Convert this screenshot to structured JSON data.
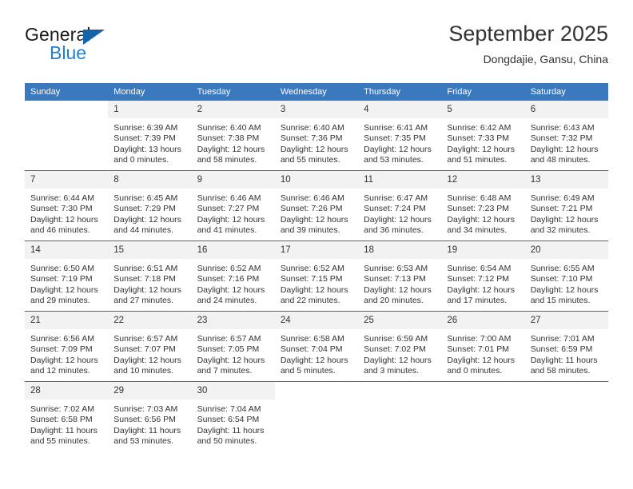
{
  "brand": {
    "name_top": "General",
    "name_bottom": "Blue",
    "triangle_icon": "brand-triangle-icon"
  },
  "header": {
    "title": "September 2025",
    "subtitle": "Dongdajie, Gansu, China"
  },
  "calendar": {
    "weekday_headers": [
      "Sunday",
      "Monday",
      "Tuesday",
      "Wednesday",
      "Thursday",
      "Friday",
      "Saturday"
    ],
    "colors": {
      "header_bg": "#3a79bd",
      "daynum_bg": "#f2f2f2",
      "row_border": "#2f6ead",
      "brand_blue": "#1f7fd0",
      "brand_triangle": "#1464aa",
      "text": "#333333"
    },
    "weeks": [
      [
        {
          "day": "",
          "sunrise": "",
          "sunset": "",
          "daylight_line1": "",
          "daylight_line2": ""
        },
        {
          "day": "1",
          "sunrise": "Sunrise: 6:39 AM",
          "sunset": "Sunset: 7:39 PM",
          "daylight_line1": "Daylight: 13 hours",
          "daylight_line2": "and 0 minutes."
        },
        {
          "day": "2",
          "sunrise": "Sunrise: 6:40 AM",
          "sunset": "Sunset: 7:38 PM",
          "daylight_line1": "Daylight: 12 hours",
          "daylight_line2": "and 58 minutes."
        },
        {
          "day": "3",
          "sunrise": "Sunrise: 6:40 AM",
          "sunset": "Sunset: 7:36 PM",
          "daylight_line1": "Daylight: 12 hours",
          "daylight_line2": "and 55 minutes."
        },
        {
          "day": "4",
          "sunrise": "Sunrise: 6:41 AM",
          "sunset": "Sunset: 7:35 PM",
          "daylight_line1": "Daylight: 12 hours",
          "daylight_line2": "and 53 minutes."
        },
        {
          "day": "5",
          "sunrise": "Sunrise: 6:42 AM",
          "sunset": "Sunset: 7:33 PM",
          "daylight_line1": "Daylight: 12 hours",
          "daylight_line2": "and 51 minutes."
        },
        {
          "day": "6",
          "sunrise": "Sunrise: 6:43 AM",
          "sunset": "Sunset: 7:32 PM",
          "daylight_line1": "Daylight: 12 hours",
          "daylight_line2": "and 48 minutes."
        }
      ],
      [
        {
          "day": "7",
          "sunrise": "Sunrise: 6:44 AM",
          "sunset": "Sunset: 7:30 PM",
          "daylight_line1": "Daylight: 12 hours",
          "daylight_line2": "and 46 minutes."
        },
        {
          "day": "8",
          "sunrise": "Sunrise: 6:45 AM",
          "sunset": "Sunset: 7:29 PM",
          "daylight_line1": "Daylight: 12 hours",
          "daylight_line2": "and 44 minutes."
        },
        {
          "day": "9",
          "sunrise": "Sunrise: 6:46 AM",
          "sunset": "Sunset: 7:27 PM",
          "daylight_line1": "Daylight: 12 hours",
          "daylight_line2": "and 41 minutes."
        },
        {
          "day": "10",
          "sunrise": "Sunrise: 6:46 AM",
          "sunset": "Sunset: 7:26 PM",
          "daylight_line1": "Daylight: 12 hours",
          "daylight_line2": "and 39 minutes."
        },
        {
          "day": "11",
          "sunrise": "Sunrise: 6:47 AM",
          "sunset": "Sunset: 7:24 PM",
          "daylight_line1": "Daylight: 12 hours",
          "daylight_line2": "and 36 minutes."
        },
        {
          "day": "12",
          "sunrise": "Sunrise: 6:48 AM",
          "sunset": "Sunset: 7:23 PM",
          "daylight_line1": "Daylight: 12 hours",
          "daylight_line2": "and 34 minutes."
        },
        {
          "day": "13",
          "sunrise": "Sunrise: 6:49 AM",
          "sunset": "Sunset: 7:21 PM",
          "daylight_line1": "Daylight: 12 hours",
          "daylight_line2": "and 32 minutes."
        }
      ],
      [
        {
          "day": "14",
          "sunrise": "Sunrise: 6:50 AM",
          "sunset": "Sunset: 7:19 PM",
          "daylight_line1": "Daylight: 12 hours",
          "daylight_line2": "and 29 minutes."
        },
        {
          "day": "15",
          "sunrise": "Sunrise: 6:51 AM",
          "sunset": "Sunset: 7:18 PM",
          "daylight_line1": "Daylight: 12 hours",
          "daylight_line2": "and 27 minutes."
        },
        {
          "day": "16",
          "sunrise": "Sunrise: 6:52 AM",
          "sunset": "Sunset: 7:16 PM",
          "daylight_line1": "Daylight: 12 hours",
          "daylight_line2": "and 24 minutes."
        },
        {
          "day": "17",
          "sunrise": "Sunrise: 6:52 AM",
          "sunset": "Sunset: 7:15 PM",
          "daylight_line1": "Daylight: 12 hours",
          "daylight_line2": "and 22 minutes."
        },
        {
          "day": "18",
          "sunrise": "Sunrise: 6:53 AM",
          "sunset": "Sunset: 7:13 PM",
          "daylight_line1": "Daylight: 12 hours",
          "daylight_line2": "and 20 minutes."
        },
        {
          "day": "19",
          "sunrise": "Sunrise: 6:54 AM",
          "sunset": "Sunset: 7:12 PM",
          "daylight_line1": "Daylight: 12 hours",
          "daylight_line2": "and 17 minutes."
        },
        {
          "day": "20",
          "sunrise": "Sunrise: 6:55 AM",
          "sunset": "Sunset: 7:10 PM",
          "daylight_line1": "Daylight: 12 hours",
          "daylight_line2": "and 15 minutes."
        }
      ],
      [
        {
          "day": "21",
          "sunrise": "Sunrise: 6:56 AM",
          "sunset": "Sunset: 7:09 PM",
          "daylight_line1": "Daylight: 12 hours",
          "daylight_line2": "and 12 minutes."
        },
        {
          "day": "22",
          "sunrise": "Sunrise: 6:57 AM",
          "sunset": "Sunset: 7:07 PM",
          "daylight_line1": "Daylight: 12 hours",
          "daylight_line2": "and 10 minutes."
        },
        {
          "day": "23",
          "sunrise": "Sunrise: 6:57 AM",
          "sunset": "Sunset: 7:05 PM",
          "daylight_line1": "Daylight: 12 hours",
          "daylight_line2": "and 7 minutes."
        },
        {
          "day": "24",
          "sunrise": "Sunrise: 6:58 AM",
          "sunset": "Sunset: 7:04 PM",
          "daylight_line1": "Daylight: 12 hours",
          "daylight_line2": "and 5 minutes."
        },
        {
          "day": "25",
          "sunrise": "Sunrise: 6:59 AM",
          "sunset": "Sunset: 7:02 PM",
          "daylight_line1": "Daylight: 12 hours",
          "daylight_line2": "and 3 minutes."
        },
        {
          "day": "26",
          "sunrise": "Sunrise: 7:00 AM",
          "sunset": "Sunset: 7:01 PM",
          "daylight_line1": "Daylight: 12 hours",
          "daylight_line2": "and 0 minutes."
        },
        {
          "day": "27",
          "sunrise": "Sunrise: 7:01 AM",
          "sunset": "Sunset: 6:59 PM",
          "daylight_line1": "Daylight: 11 hours",
          "daylight_line2": "and 58 minutes."
        }
      ],
      [
        {
          "day": "28",
          "sunrise": "Sunrise: 7:02 AM",
          "sunset": "Sunset: 6:58 PM",
          "daylight_line1": "Daylight: 11 hours",
          "daylight_line2": "and 55 minutes."
        },
        {
          "day": "29",
          "sunrise": "Sunrise: 7:03 AM",
          "sunset": "Sunset: 6:56 PM",
          "daylight_line1": "Daylight: 11 hours",
          "daylight_line2": "and 53 minutes."
        },
        {
          "day": "30",
          "sunrise": "Sunrise: 7:04 AM",
          "sunset": "Sunset: 6:54 PM",
          "daylight_line1": "Daylight: 11 hours",
          "daylight_line2": "and 50 minutes."
        },
        {
          "day": "",
          "sunrise": "",
          "sunset": "",
          "daylight_line1": "",
          "daylight_line2": ""
        },
        {
          "day": "",
          "sunrise": "",
          "sunset": "",
          "daylight_line1": "",
          "daylight_line2": ""
        },
        {
          "day": "",
          "sunrise": "",
          "sunset": "",
          "daylight_line1": "",
          "daylight_line2": ""
        },
        {
          "day": "",
          "sunrise": "",
          "sunset": "",
          "daylight_line1": "",
          "daylight_line2": ""
        }
      ]
    ]
  }
}
